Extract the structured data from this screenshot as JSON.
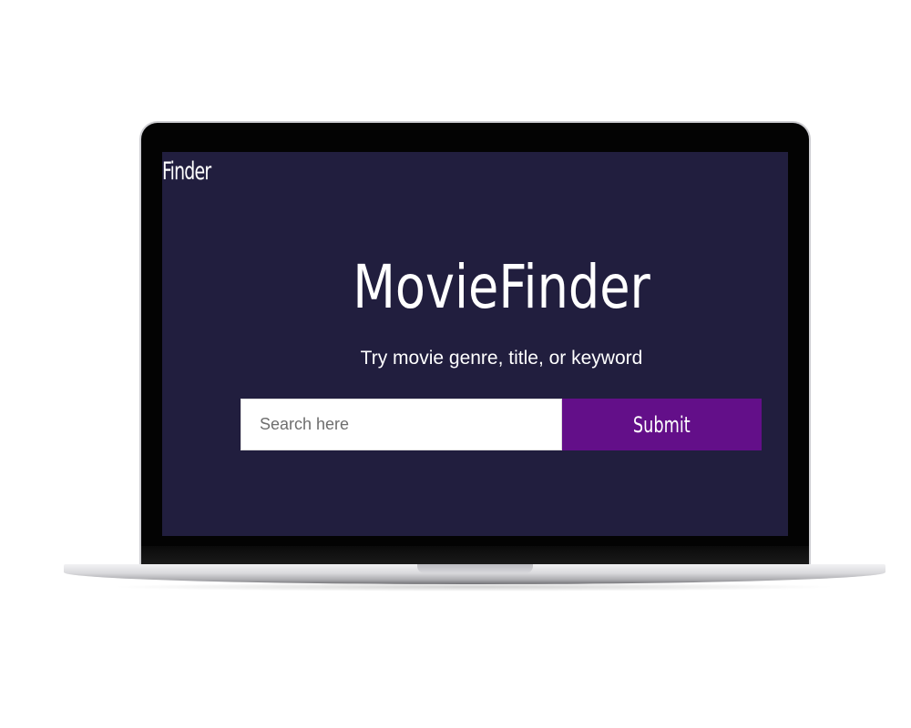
{
  "nav": {
    "brand": "Finder"
  },
  "hero": {
    "title": "MovieFinder",
    "subtitle": "Try movie genre, title, or keyword"
  },
  "search": {
    "placeholder": "Search here",
    "value": "",
    "submit_label": "Submit"
  },
  "colors": {
    "screen_background": "#211e3e",
    "accent": "#630f89",
    "text": "#ffffff"
  },
  "icons": {
    "device": "laptop-frame"
  }
}
